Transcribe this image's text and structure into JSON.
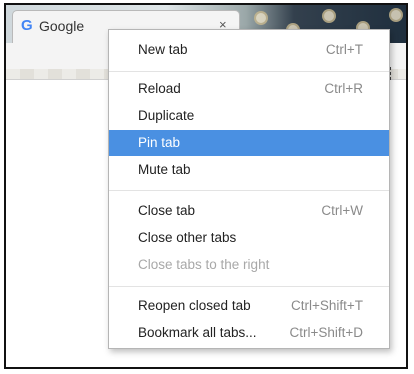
{
  "tab": {
    "title": "Google",
    "favicon": "G",
    "close_glyph": "×"
  },
  "icons": {
    "favicon": "google-g-icon",
    "tab_close": "close-icon",
    "menu": "vertical-dots-icon"
  },
  "colors": {
    "highlight": "#4a90e2",
    "disabled_text": "#a8a8a8",
    "shortcut_text": "#8a8a8a"
  },
  "context_menu": {
    "items": [
      {
        "label": "New tab",
        "shortcut": "Ctrl+T"
      },
      {
        "label": "Reload",
        "shortcut": "Ctrl+R"
      },
      {
        "label": "Duplicate",
        "shortcut": ""
      },
      {
        "label": "Pin tab",
        "shortcut": ""
      },
      {
        "label": "Mute tab",
        "shortcut": ""
      },
      {
        "label": "Close tab",
        "shortcut": "Ctrl+W"
      },
      {
        "label": "Close other tabs",
        "shortcut": ""
      },
      {
        "label": "Close tabs to the right",
        "shortcut": ""
      },
      {
        "label": "Reopen closed tab",
        "shortcut": "Ctrl+Shift+T"
      },
      {
        "label": "Bookmark all tabs...",
        "shortcut": "Ctrl+Shift+D"
      }
    ],
    "highlighted_item": "Pin tab",
    "disabled_item": "Close tabs to the right"
  }
}
